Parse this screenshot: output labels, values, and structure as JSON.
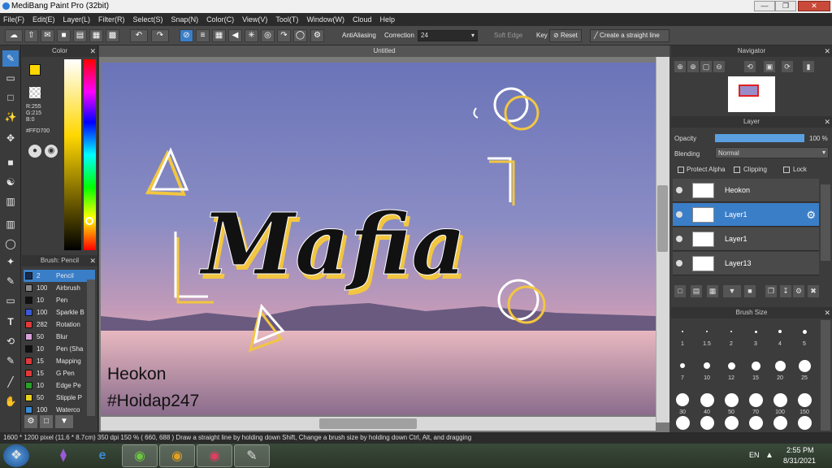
{
  "app": {
    "title": "MediBang Paint Pro (32bit)"
  },
  "menu": [
    "File(F)",
    "Edit(E)",
    "Layer(L)",
    "Filter(R)",
    "Select(S)",
    "Snap(N)",
    "Color(C)",
    "View(V)",
    "Tool(T)",
    "Window(W)",
    "Cloud",
    "Help"
  ],
  "toolbar": {
    "antialiasing_label": "AntiAliasing",
    "correction_label": "Correction",
    "correction_value": "24",
    "soft_edge_label": "Soft Edge",
    "key_label": "Key",
    "reset_label": "Reset",
    "straight_line_label": "Create a straight line"
  },
  "color_panel": {
    "title": "Color",
    "r": "R:255",
    "g": "G:215",
    "b": "B:0",
    "hex": "#FFD700",
    "fg_color": "#FFD700",
    "bg_color": "#FFFFFF"
  },
  "brush_panel": {
    "title": "Brush: Pencil",
    "items": [
      {
        "size": "2",
        "name": "Pencil",
        "color": "#1a2a4a",
        "selected": true
      },
      {
        "size": "100",
        "name": "Airbrush",
        "color": "#888888"
      },
      {
        "size": "10",
        "name": "Pen",
        "color": "#111111"
      },
      {
        "size": "100",
        "name": "Sparkle B",
        "color": "#3a5ad6"
      },
      {
        "size": "282",
        "name": "Rotation",
        "color": "#e03a3a"
      },
      {
        "size": "50",
        "name": "Blur",
        "color": "#d8a0d8"
      },
      {
        "size": "10",
        "name": "Pen (Sha",
        "color": "#111111"
      },
      {
        "size": "15",
        "name": "Mapping",
        "color": "#e03a3a"
      },
      {
        "size": "15",
        "name": "G Pen",
        "color": "#e03a3a"
      },
      {
        "size": "10",
        "name": "Edge Pe",
        "color": "#2aa02a"
      },
      {
        "size": "50",
        "name": "Stipple P",
        "color": "#e8d020"
      },
      {
        "size": "100",
        "name": "Waterco",
        "color": "#3a8ad6"
      }
    ]
  },
  "document": {
    "tab_title": "Untitled",
    "title_text": "Mafia",
    "signature_line1": "Heokon",
    "signature_line2": "#Hoidap247"
  },
  "navigator": {
    "title": "Navigator"
  },
  "layer_panel": {
    "title": "Layer",
    "opacity_label": "Opacity",
    "opacity_value": "100 %",
    "opacity_fraction": 1.0,
    "blending_label": "Blending",
    "blending_value": "Normal",
    "protect_alpha_label": "Protect Alpha",
    "clipping_label": "Clipping",
    "lock_label": "Lock",
    "layers": [
      {
        "name": "Heokon",
        "selected": false
      },
      {
        "name": "Layer1",
        "selected": true
      },
      {
        "name": "Layer1",
        "selected": false
      },
      {
        "name": "Layer13",
        "selected": false
      }
    ]
  },
  "brush_size_panel": {
    "title": "Brush Size",
    "sizes": [
      "1",
      "1.5",
      "2",
      "3",
      "4",
      "5",
      "7",
      "10",
      "12",
      "15",
      "20",
      "25",
      "30",
      "40",
      "50",
      "70",
      "100",
      "150"
    ]
  },
  "status": {
    "text": "1600 * 1200 pixel   (11.6 * 8.7cm)   350 dpi   150 %   ( 660, 688 )   Draw a straight line by holding down Shift, Change a brush size by holding down Ctrl, Alt, and dragging"
  },
  "taskbar": {
    "lang": "EN",
    "time": "2:55 PM",
    "date": "8/31/2021"
  }
}
